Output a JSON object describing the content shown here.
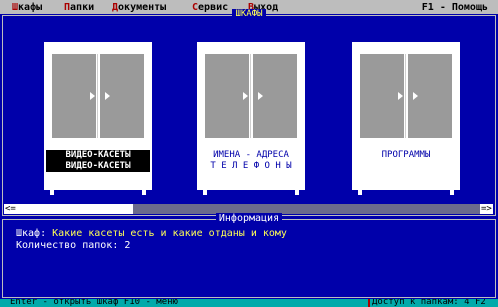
{
  "menu": {
    "items": [
      {
        "hot": "Ш",
        "rest": "кафы"
      },
      {
        "hot": "П",
        "rest": "апки"
      },
      {
        "hot": "Д",
        "rest": "окументы"
      },
      {
        "hot": "С",
        "rest": "ервис"
      },
      {
        "hot": "В",
        "rest": "ыход"
      }
    ],
    "help": "F1 - Помощь"
  },
  "cabinets_panel": {
    "title": "ШКАФЫ",
    "cabinets": [
      {
        "line1": "ВИДЕО-КАСЕТЫ",
        "line2": "ВИДЕО-КАСЕТЫ",
        "selected": true
      },
      {
        "line1": "ИМЕНА - АДРЕСА",
        "line2": "Т Е Л Е Ф О Н Ы",
        "selected": false
      },
      {
        "line1": "ПРОГРАММЫ",
        "line2": "",
        "selected": false
      }
    ],
    "scroll_left": "<=",
    "scroll_right": "=>",
    "scroll_position": 0.25
  },
  "info_panel": {
    "title": "Информация",
    "cabinet_label": "Шкаф:",
    "cabinet_value": "Какие касеты есть и какие отданы и кому",
    "folders_label": "Количество папок:",
    "folders_value": "2"
  },
  "statusbar": {
    "left": "Enter - открыть шкаф  F10 - меню",
    "right": "Доступ к папкам: 4 F2"
  },
  "colors": {
    "background": "#0000aa",
    "menubar": "#bdbdbd",
    "hotkey": "#aa0000",
    "highlight_text": "#ffff55",
    "statusbar": "#00aaaa"
  }
}
